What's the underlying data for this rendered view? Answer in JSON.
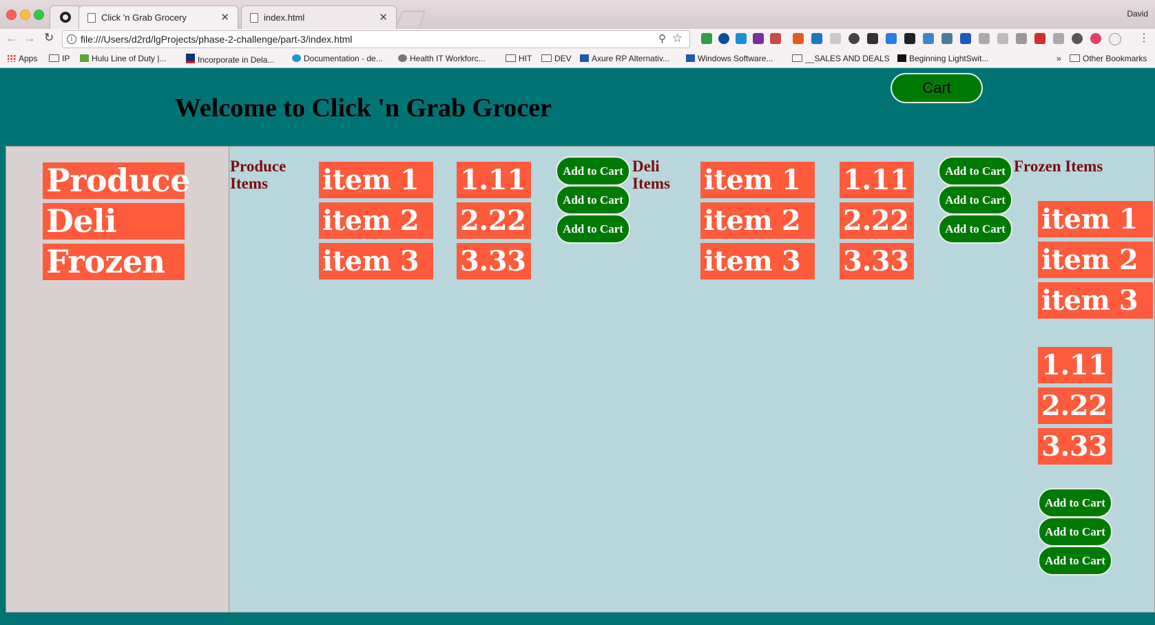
{
  "browser": {
    "tabs": [
      {
        "title": "Click 'n Grab Grocery",
        "active": true
      },
      {
        "title": "index.html",
        "active": false
      }
    ],
    "profile_name": "David",
    "url": "file:///Users/d2rd/lgProjects/phase-2-challenge/part-3/index.html",
    "bookmarks": [
      {
        "label": "Apps",
        "icon": "apps-icon"
      },
      {
        "label": "IP",
        "icon": "folder-icon"
      },
      {
        "label": "Hulu Line of Duty |...",
        "icon": "hulu-icon"
      },
      {
        "label": "Incorporate in Dela...",
        "icon": "hbs-icon"
      },
      {
        "label": "Documentation - de...",
        "icon": "salesforce-icon"
      },
      {
        "label": "Health IT Workforc...",
        "icon": "caduceus-icon"
      },
      {
        "label": "HIT",
        "icon": "folder-icon"
      },
      {
        "label": "DEV",
        "icon": "folder-icon"
      },
      {
        "label": "Axure RP Alternativ...",
        "icon": "alternativeto-icon"
      },
      {
        "label": "Windows Software...",
        "icon": "alternativeto-icon"
      },
      {
        "label": "__SALES AND DEALS",
        "icon": "folder-icon"
      },
      {
        "label": "Beginning LightSwit...",
        "icon": "m-icon"
      }
    ],
    "overflow_label": "»",
    "other_bookmarks": "Other Bookmarks"
  },
  "header": {
    "title": "Welcome to Click 'n Grab Grocer",
    "cart_label": "Cart"
  },
  "sidebar": {
    "items": [
      {
        "label": "Produce"
      },
      {
        "label": "Deli"
      },
      {
        "label": "Frozen"
      }
    ]
  },
  "sections": {
    "produce": {
      "heading": "Produce Items",
      "items": [
        {
          "name": "item 1",
          "price": "1.11",
          "button": "Add to Cart"
        },
        {
          "name": "item 2",
          "price": "2.22",
          "button": "Add to Cart"
        },
        {
          "name": "item 3",
          "price": "3.33",
          "button": "Add to Cart"
        }
      ]
    },
    "deli": {
      "heading": "Deli Items",
      "items": [
        {
          "name": "item 1",
          "price": "1.11",
          "button": "Add to Cart"
        },
        {
          "name": "item 2",
          "price": "2.22",
          "button": "Add to Cart"
        },
        {
          "name": "item 3",
          "price": "3.33",
          "button": "Add to Cart"
        }
      ]
    },
    "frozen": {
      "heading": "Frozen Items",
      "items": [
        {
          "name": "item 1",
          "price": "1.11",
          "button": "Add to Cart"
        },
        {
          "name": "item 2",
          "price": "2.22",
          "button": "Add to Cart"
        },
        {
          "name": "item 3",
          "price": "3.33",
          "button": "Add to Cart"
        }
      ]
    }
  },
  "colors": {
    "header_bg": "#007375",
    "sidebar_bg": "#d9d1d1",
    "main_bg": "#b8d6dc",
    "chip_bg": "#fe5b3c",
    "button_bg": "#017a05",
    "heading_color": "#7b0a0f"
  }
}
